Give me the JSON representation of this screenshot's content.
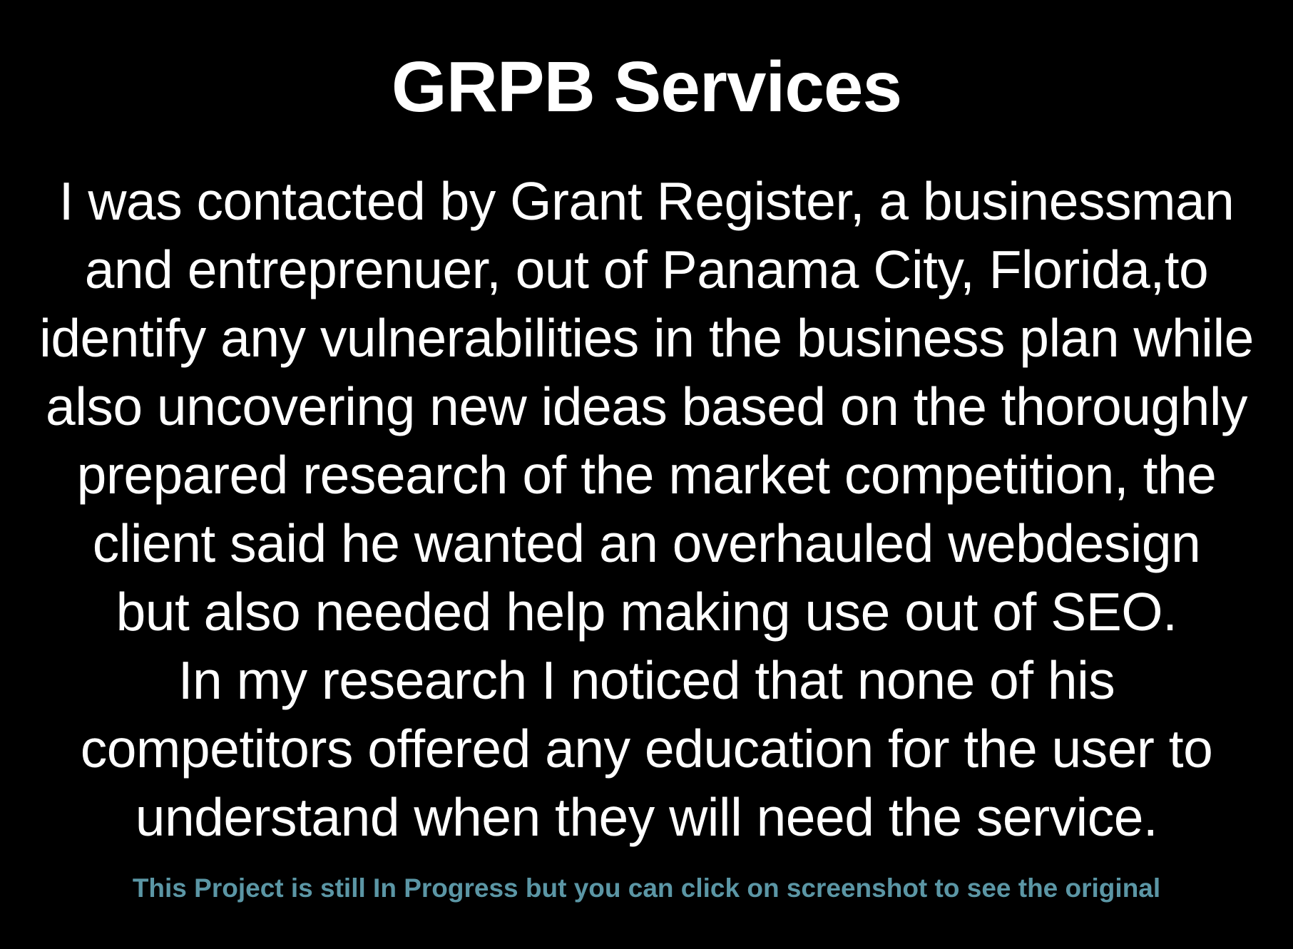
{
  "title": "GRPB Services",
  "description_lines": [
    "I was contacted by Grant Register, a businessman",
    "and entreprenuer, out of Panama City, Florida,to",
    "identify any vulnerabilities in the business plan while",
    "also uncovering new ideas based on the thoroughly",
    "prepared research of the market competition, the",
    "client said he wanted an overhauled webdesign",
    "but also needed help making use out of SEO.",
    "In my research I noticed that none of his",
    "competitors offered any education for the user to",
    "understand when they will need the service."
  ],
  "footer_link": "This Project is still In Progress but you can click on screenshot to see the original",
  "colors": {
    "background": "#000000",
    "text": "#ffffff",
    "link": "#5b96a5"
  }
}
